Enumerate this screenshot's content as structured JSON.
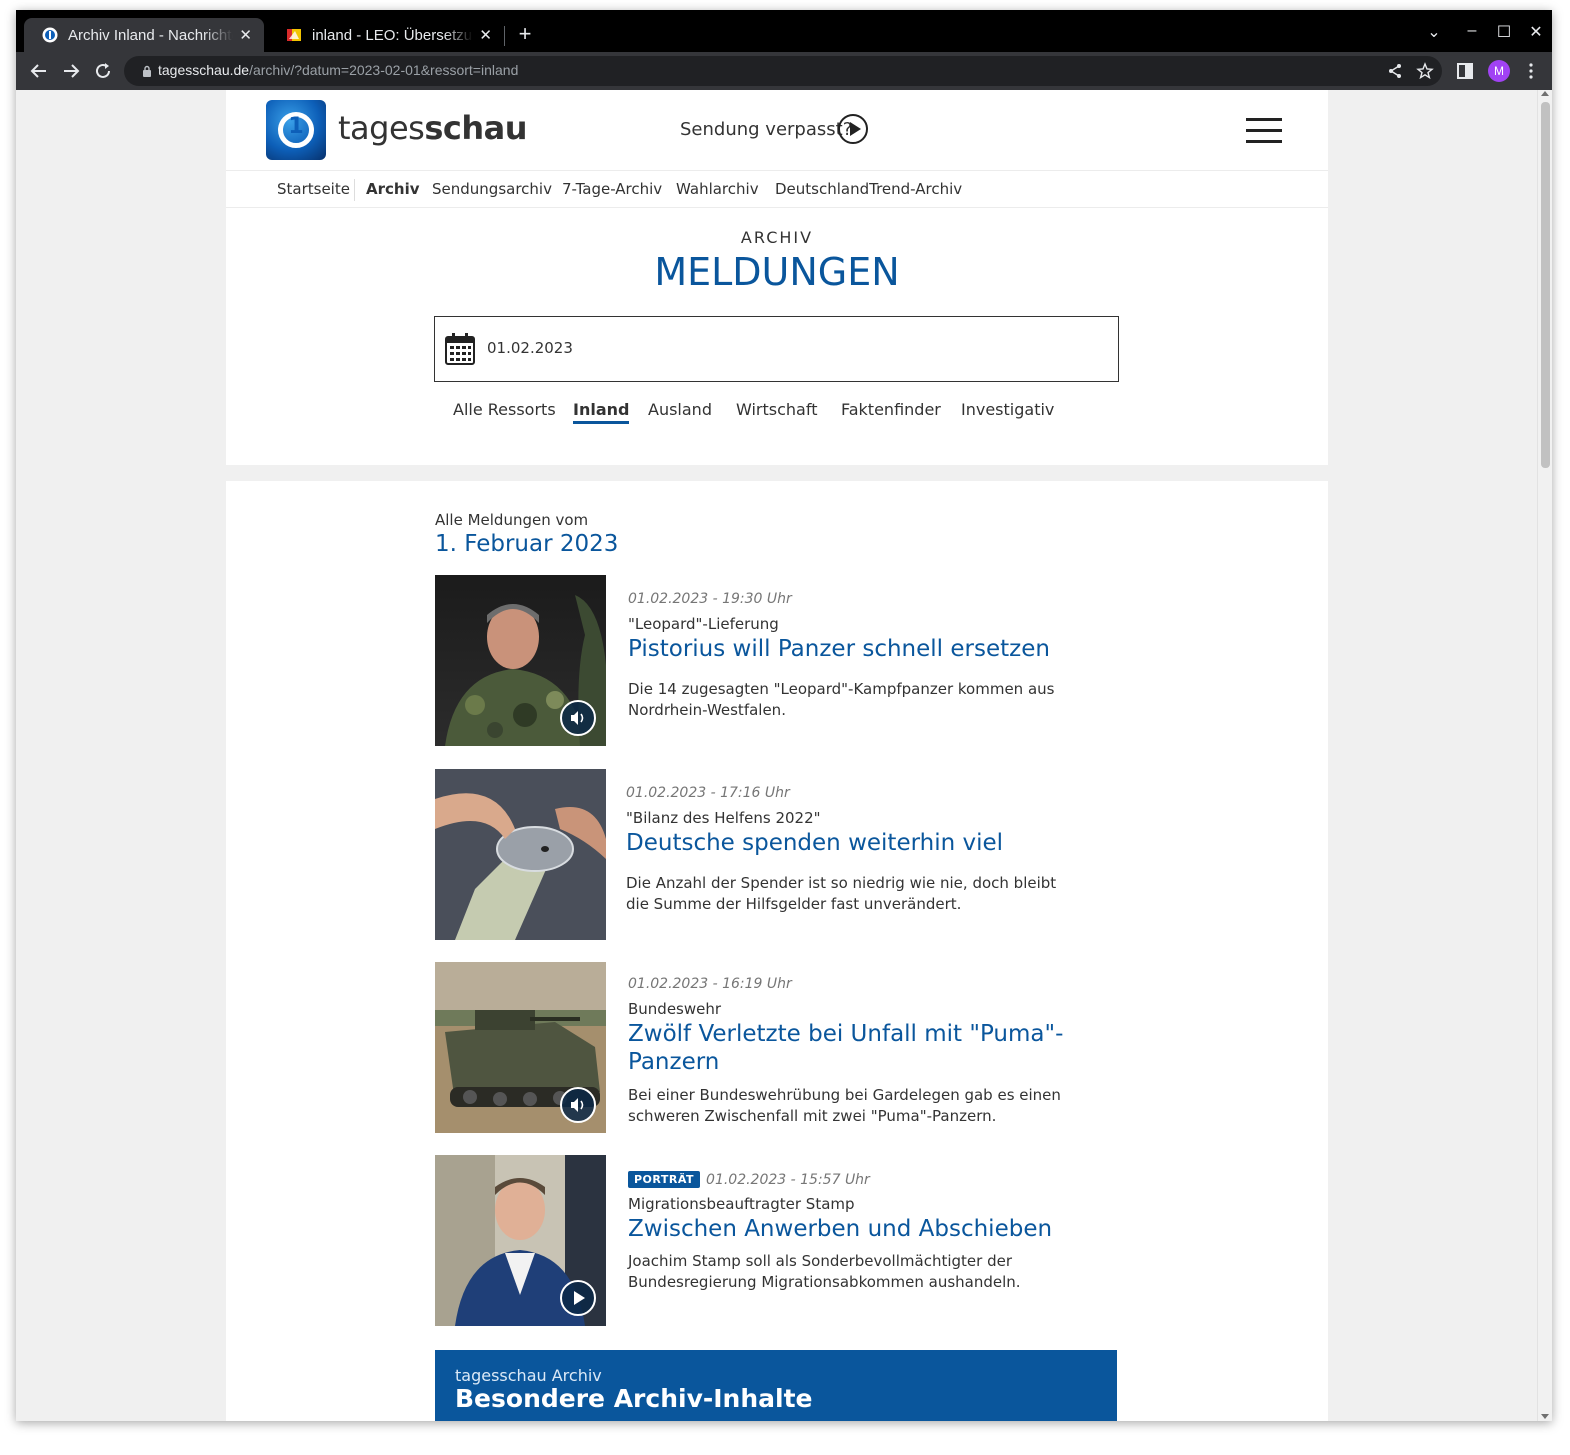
{
  "browser": {
    "tabs": [
      {
        "title": "Archiv Inland - Nachrichten",
        "active": true
      },
      {
        "title": "inland - LEO: Übersetzung",
        "active": false
      }
    ],
    "url_host": "tagesschau.de",
    "url_path": "/archiv/?datum=2023-02-01&ressort=inland",
    "profile_initial": "M",
    "accent": "#a142f4"
  },
  "header": {
    "brand_light": "tages",
    "brand_bold": "schau",
    "missed_label": "Sendung verpasst?",
    "logo_mark": "1"
  },
  "subnav": [
    {
      "label": "Startseite"
    },
    {
      "label": "Archiv"
    },
    {
      "label": "Sendungsarchiv"
    },
    {
      "label": "7-Tage-Archiv"
    },
    {
      "label": "Wahlarchiv"
    },
    {
      "label": "DeutschlandTrend-Archiv"
    }
  ],
  "archive": {
    "kicker": "ARCHIV",
    "headline": "MELDUNGEN",
    "date_value": "01.02.2023"
  },
  "ressorts": [
    {
      "label": "Alle Ressorts"
    },
    {
      "label": "Inland"
    },
    {
      "label": "Ausland"
    },
    {
      "label": "Wirtschaft"
    },
    {
      "label": "Faktenfinder"
    },
    {
      "label": "Investigativ"
    }
  ],
  "list": {
    "intro": "Alle Meldungen vom",
    "date": "1. Februar 2023"
  },
  "teasers": [
    {
      "meta": "01.02.2023 - 19:30 Uhr",
      "topline": "\"Leopard\"-Lieferung",
      "title": "Pistorius will Panzer schnell ersetzen",
      "desc": "Die 14 zugesagten \"Leopard\"-Kampfpanzer kommen aus Nordrhein-Westfalen.",
      "media": "audio-icon"
    },
    {
      "meta": "01.02.2023 - 17:16 Uhr",
      "topline": "\"Bilanz des Helfens 2022\"",
      "title": "Deutsche spenden weiterhin viel",
      "desc": "Die Anzahl der Spender ist so niedrig wie nie, doch bleibt die Summe der Hilfsgelder fast unverändert.",
      "media": ""
    },
    {
      "meta": "01.02.2023 - 16:19 Uhr",
      "topline": "Bundeswehr",
      "title": "Zwölf Verletzte bei Unfall mit \"Puma\"-Panzern",
      "desc": "Bei einer Bundeswehrübung bei Gardelegen gab es einen schweren Zwischenfall mit zwei \"Puma\"-Panzern.",
      "media": "audio-icon"
    },
    {
      "badge": "PORTRÄT",
      "meta": "01.02.2023 - 15:57 Uhr",
      "topline": "Migrationsbeauftragter Stamp",
      "title": "Zwischen Anwerben und Abschieben",
      "desc": "Joachim Stamp soll als Sonderbevollmächtigter der Bundesregierung Migrationsabkommen aushandeln.",
      "media": "play-icon"
    }
  ],
  "promo": {
    "sub": "tagesschau Archiv",
    "title": "Besondere Archiv-Inhalte"
  },
  "colors": {
    "brand_blue": "#0a569c",
    "text": "#333333"
  }
}
